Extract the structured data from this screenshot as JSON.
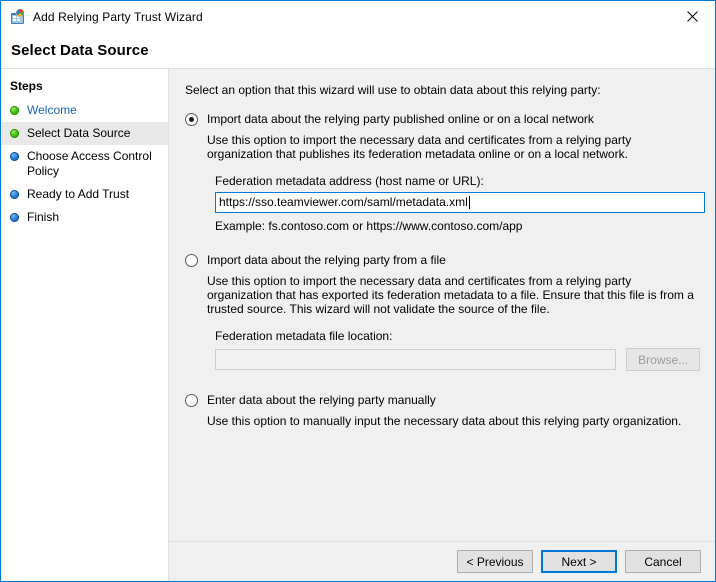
{
  "window": {
    "title": "Add Relying Party Trust Wizard",
    "icon": "wizard-app-icon",
    "close_icon": "close-icon",
    "accent_color": "#0078d7"
  },
  "header": {
    "title": "Select Data Source"
  },
  "sidebar": {
    "title": "Steps",
    "items": [
      {
        "label": "Welcome",
        "state": "done",
        "style": "link",
        "selected": false
      },
      {
        "label": "Select Data Source",
        "state": "done",
        "style": "normal",
        "selected": true
      },
      {
        "label": "Choose Access Control Policy",
        "state": "todo",
        "style": "normal",
        "selected": false
      },
      {
        "label": "Ready to Add Trust",
        "state": "todo",
        "style": "normal",
        "selected": false
      },
      {
        "label": "Finish",
        "state": "todo",
        "style": "normal",
        "selected": false
      }
    ]
  },
  "main": {
    "intro": "Select an option that this wizard will use to obtain data about this relying party:",
    "option1": {
      "label": "Import data about the relying party published online or on a local network",
      "selected": true,
      "description": "Use this option to import the necessary data and certificates from a relying party organization that publishes its federation metadata online or on a local network.",
      "field_label": "Federation metadata address (host name or URL):",
      "field_value": "https://sso.teamviewer.com/saml/metadata.xml",
      "example": "Example: fs.contoso.com or https://www.contoso.com/app"
    },
    "option2": {
      "label": "Import data about the relying party from a file",
      "selected": false,
      "description": "Use this option to import the necessary data and certificates from a relying party organization that has exported its federation metadata to a file. Ensure that this file is from a trusted source.  This wizard will not validate the source of the file.",
      "field_label": "Federation metadata file location:",
      "field_value": "",
      "browse_label": "Browse..."
    },
    "option3": {
      "label": "Enter data about the relying party manually",
      "selected": false,
      "description": "Use this option to manually input the necessary data about this relying party organization."
    }
  },
  "footer": {
    "previous_label": "< Previous",
    "next_label": "Next >",
    "cancel_label": "Cancel"
  }
}
